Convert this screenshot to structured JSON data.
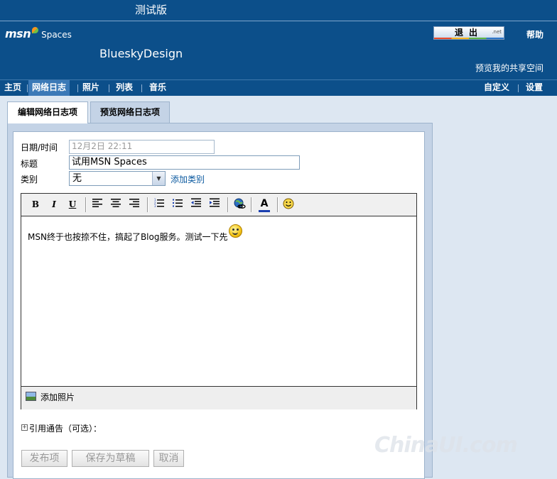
{
  "topbar": {
    "beta_label": "测试版"
  },
  "header": {
    "logo_msn": "msn",
    "logo_spaces": "Spaces",
    "space_title": "BlueskyDesign",
    "logout": "退出",
    "logout_net": ".net",
    "help": "帮助",
    "preview_share": "预览我的共享空间"
  },
  "nav": {
    "items": [
      "主页",
      "网络日志",
      "照片",
      "列表",
      "音乐"
    ],
    "active": "网络日志",
    "right": [
      "自定义",
      "设置"
    ]
  },
  "tabs": {
    "edit": "编辑网络日志项",
    "preview": "预览网络日志项"
  },
  "form": {
    "datetime_label": "日期/时间",
    "datetime_value": "12月2日 22:11",
    "title_label": "标题",
    "title_value": "试用MSN Spaces",
    "category_label": "类别",
    "category_value": "无",
    "add_category": "添加类别"
  },
  "toolbar": {
    "bold": "B",
    "italic": "I",
    "underline": "U",
    "icons": [
      "align-left-icon",
      "align-center-icon",
      "align-right-icon",
      "numbered-list-icon",
      "bullet-list-icon",
      "outdent-icon",
      "indent-icon",
      "hyperlink-icon",
      "font-color-icon",
      "emoticon-icon"
    ],
    "font_color_glyph": "A",
    "font_color": "#1a3fb0"
  },
  "editor": {
    "content": "MSN终于也按捺不住，搞起了Blog服务。测试一下先"
  },
  "photo": {
    "add_photo": "添加照片"
  },
  "trackback": {
    "label": "引用通告（可选）："
  },
  "buttons": {
    "publish": "发布项",
    "save_draft": "保存为草稿",
    "cancel": "取消"
  },
  "watermark": {
    "text": "ChinaUI.com"
  },
  "colors": {
    "header_bg": "#0c4f8a",
    "nav_active": "#3b79b7",
    "panel_bg": "#c4d3e6",
    "page_bg": "#dde7f2",
    "link": "#0c5aa0"
  }
}
